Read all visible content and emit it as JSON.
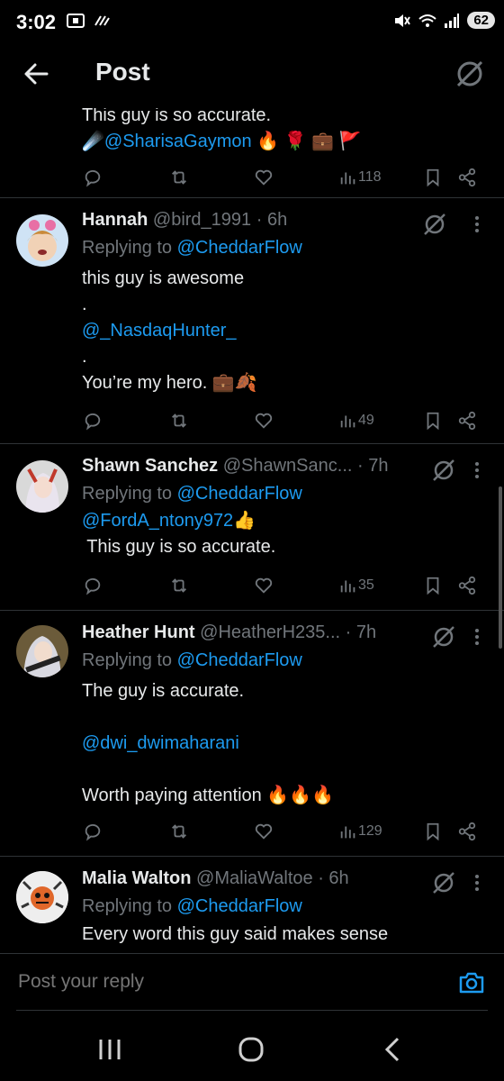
{
  "status_bar": {
    "time": "3:02",
    "battery": "62"
  },
  "header": {
    "title": "Post",
    "icons": {
      "back": "arrow-left-icon",
      "grok": "grok-icon"
    }
  },
  "top_post": {
    "text": "This guy is so accurate.",
    "mention": "@SharisaGaymon",
    "emoji_tail": "🔥 🌹 💼 🚩",
    "views": "118"
  },
  "replies": [
    {
      "name": "Hannah",
      "handle": "@bird_1991",
      "time": "· 6h",
      "replying_prefix": "Replying to",
      "replying_to": "@CheddarFlow",
      "lines": [
        "this guy is awesome",
        ".",
        "@_NasdaqHunter_",
        ".",
        "You’re my hero. 💼🍂"
      ],
      "views": "49"
    },
    {
      "name": "Shawn Sanchez",
      "handle": "@ShawnSanc...",
      "time": "· 7h",
      "replying_prefix": "Replying to",
      "replying_to": "@CheddarFlow",
      "lines": [
        "@FordA_ntony972👍",
        " This guy is so accurate."
      ],
      "views": "35"
    },
    {
      "name": "Heather Hunt",
      "handle": "@HeatherH235...",
      "time": "· 7h",
      "replying_prefix": "Replying to",
      "replying_to": "@CheddarFlow",
      "lines": [
        "The guy is accurate.",
        "",
        "@dwi_dwimaharani",
        "",
        "Worth paying attention 🔥🔥🔥"
      ],
      "views": "129"
    },
    {
      "name": "Malia Walton",
      "handle": "@MaliaWaltoe",
      "time": "· 6h",
      "replying_prefix": "Replying to",
      "replying_to": "@CheddarFlow",
      "lines": [
        "Every word this guy said makes sense"
      ],
      "views": ""
    }
  ],
  "composer": {
    "placeholder": "Post your reply"
  },
  "colors": {
    "background": "#000000",
    "link": "#1d9bf0",
    "muted": "#71767b",
    "text": "#e7e9ea",
    "divider": "#2f3336"
  }
}
